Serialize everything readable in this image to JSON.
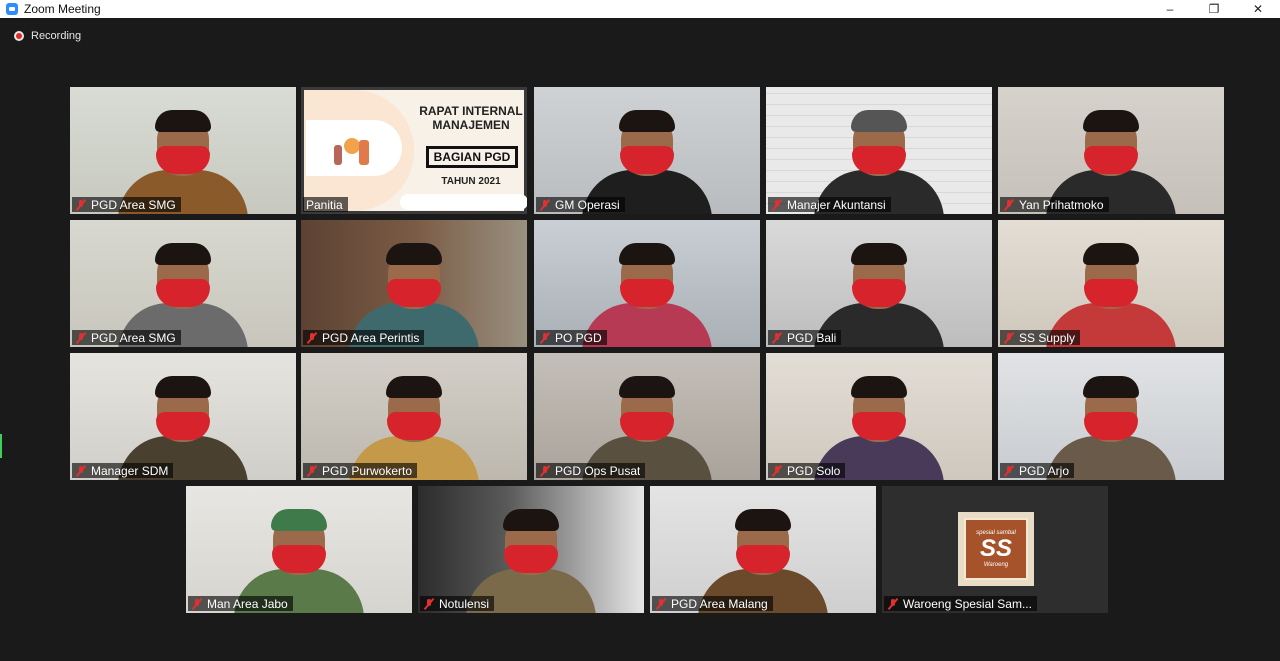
{
  "window": {
    "title": "Zoom Meeting",
    "minimize": "–",
    "restore": "❐",
    "close": "✕"
  },
  "recording": {
    "label": "Recording"
  },
  "banner": {
    "line1": "RAPAT INTERNAL",
    "line2": "MANAJEMEN",
    "boxed": "BAGIAN PGD",
    "year": "TAHUN 2021"
  },
  "logo": {
    "top": "spesial sambal",
    "big": "SS",
    "bottom": "Waroeng"
  },
  "participants": [
    {
      "name": "PGD Area SMG",
      "muted": true
    },
    {
      "name": "Panitia",
      "muted": false,
      "active": true
    },
    {
      "name": "GM Operasi",
      "muted": true
    },
    {
      "name": "Manajer Akuntansi",
      "muted": true
    },
    {
      "name": "Yan Prihatmoko",
      "muted": true
    },
    {
      "name": "PGD Area SMG",
      "muted": true
    },
    {
      "name": "PGD Area Perintis",
      "muted": true
    },
    {
      "name": "PO PGD",
      "muted": true
    },
    {
      "name": "PGD Bali",
      "muted": true
    },
    {
      "name": "SS Supply",
      "muted": true
    },
    {
      "name": "Manager SDM",
      "muted": true
    },
    {
      "name": "PGD Purwokerto",
      "muted": true
    },
    {
      "name": "PGD Ops Pusat",
      "muted": true
    },
    {
      "name": "PGD Solo",
      "muted": true
    },
    {
      "name": "PGD Arjo",
      "muted": true
    },
    {
      "name": "Man Area Jabo",
      "muted": true
    },
    {
      "name": "Notulensi",
      "muted": true
    },
    {
      "name": "PGD Area Malang",
      "muted": true
    },
    {
      "name": "Waroeng Spesial Sam...",
      "muted": true
    }
  ],
  "colors": {
    "accent_active": "#b8e04a",
    "mute_red": "#e23030",
    "mask_red": "#d7232b",
    "background": "#1a1a1a"
  }
}
